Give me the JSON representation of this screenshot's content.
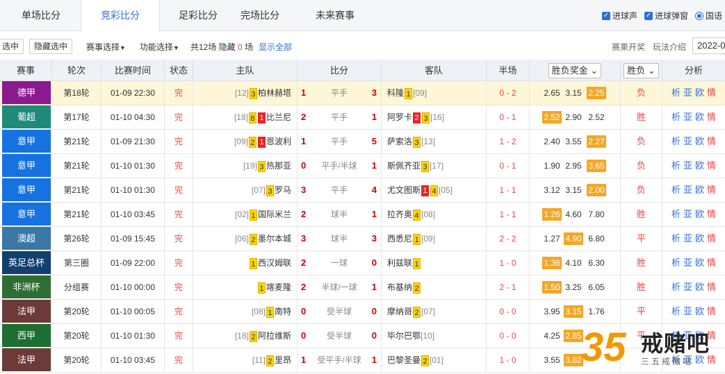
{
  "tabs": [
    "单场比分",
    "竞彩比分",
    "足彩比分",
    "完场比分",
    "未来赛事"
  ],
  "options": [
    {
      "label": "进球声",
      "type": "checkbox"
    },
    {
      "label": "进球弹窗",
      "type": "checkbox"
    },
    {
      "label": "国语",
      "type": "radio"
    }
  ],
  "toolbar": {
    "keep_selected": "选中",
    "hide_selected": "隐藏选中",
    "match_select": "赛事选择",
    "func_select": "功能选择",
    "total_prefix": "共12场 隐藏",
    "hidden_count": "0",
    "hidden_suffix": "场",
    "show_all": "显示全部",
    "open_btn": "赛果开奖",
    "rules_btn": "玩法介绍",
    "season": "2022-0"
  },
  "columns": [
    "赛事",
    "轮次",
    "比赛时间",
    "状态",
    "主队",
    "比分",
    "客队",
    "半场",
    "胜负奖金",
    "胜负",
    "分析"
  ],
  "analysis_items": [
    "析",
    "亚",
    "欧",
    "情"
  ],
  "matches": [
    {
      "league": "德甲",
      "color": "#8b1a8f",
      "round": "第18轮",
      "time": "01-09 22:30",
      "status": "完",
      "home_rank": "[12]",
      "home_cards": [
        {
          "t": "y",
          "n": "3"
        }
      ],
      "home": "柏林赫塔",
      "hs": "1",
      "handicap": "平手",
      "as": "3",
      "away": "科隆",
      "away_cards": [
        {
          "t": "y",
          "n": "1"
        }
      ],
      "away_rank": "[09]",
      "half": "0 - 2",
      "odds": [
        "2.65",
        "3.15",
        "2.25"
      ],
      "win_idx": 2,
      "result": "负"
    },
    {
      "league": "葡超",
      "color": "#1f8a7a",
      "round": "第17轮",
      "time": "01-10 04:30",
      "status": "完",
      "home_rank": "[18]",
      "home_cards": [
        {
          "t": "y",
          "n": "8"
        },
        {
          "t": "r",
          "n": "1"
        }
      ],
      "home": "比兰尼",
      "hs": "2",
      "handicap": "平手",
      "as": "1",
      "away": "阿罗卡",
      "away_cards": [
        {
          "t": "r",
          "n": "2"
        },
        {
          "t": "y",
          "n": "3"
        }
      ],
      "away_rank": "[16]",
      "half": "0 - 1",
      "odds": [
        "2.52",
        "2.90",
        "2.52"
      ],
      "win_idx": 0,
      "result": "胜"
    },
    {
      "league": "意甲",
      "color": "#1672e0",
      "round": "第21轮",
      "time": "01-09 21:30",
      "status": "完",
      "home_rank": "[09]",
      "home_cards": [
        {
          "t": "y",
          "n": "2"
        },
        {
          "t": "r",
          "n": "1"
        }
      ],
      "home": "恩波利",
      "hs": "1",
      "handicap": "平手",
      "as": "5",
      "away": "萨索洛",
      "away_cards": [
        {
          "t": "y",
          "n": "3"
        }
      ],
      "away_rank": "[13]",
      "half": "1 - 2",
      "odds": [
        "2.40",
        "3.55",
        "2.27"
      ],
      "win_idx": 2,
      "result": "负"
    },
    {
      "league": "意甲",
      "color": "#1672e0",
      "round": "第21轮",
      "time": "01-10 01:30",
      "status": "完",
      "home_rank": "[19]",
      "home_cards": [
        {
          "t": "y",
          "n": "3"
        }
      ],
      "home": "热那亚",
      "hs": "0",
      "handicap": "平手/半球",
      "as": "1",
      "away": "斯佩齐亚",
      "away_cards": [
        {
          "t": "y",
          "n": "3"
        }
      ],
      "away_rank": "[17]",
      "half": "0 - 1",
      "odds": [
        "1.90",
        "2.95",
        "3.65"
      ],
      "win_idx": 2,
      "result": "负"
    },
    {
      "league": "意甲",
      "color": "#1672e0",
      "round": "第21轮",
      "time": "01-10 01:30",
      "status": "完",
      "home_rank": "[07]",
      "home_cards": [
        {
          "t": "y",
          "n": "3"
        }
      ],
      "home": "罗马",
      "hs": "3",
      "handicap": "平手",
      "as": "4",
      "away": "尤文图斯",
      "away_cards": [
        {
          "t": "r",
          "n": "1"
        },
        {
          "t": "y",
          "n": "4"
        }
      ],
      "away_rank": "[05]",
      "half": "1 - 1",
      "odds": [
        "3.12",
        "3.15",
        "2.00"
      ],
      "win_idx": 2,
      "result": "负"
    },
    {
      "league": "意甲",
      "color": "#1672e0",
      "round": "第21轮",
      "time": "01-10 03:45",
      "status": "完",
      "home_rank": "[02]",
      "home_cards": [
        {
          "t": "y",
          "n": "1"
        }
      ],
      "home": "国际米兰",
      "hs": "2",
      "handicap": "球半",
      "as": "1",
      "away": "拉齐奥",
      "away_cards": [
        {
          "t": "y",
          "n": "4"
        }
      ],
      "away_rank": "[08]",
      "half": "1 - 1",
      "odds": [
        "1.26",
        "4.60",
        "7.80"
      ],
      "win_idx": 0,
      "result": "胜"
    },
    {
      "league": "澳超",
      "color": "#3a78a8",
      "round": "第26轮",
      "time": "01-09 15:45",
      "status": "完",
      "home_rank": "[06]",
      "home_cards": [
        {
          "t": "y",
          "n": "2"
        }
      ],
      "home": "墨尔本城",
      "hs": "3",
      "handicap": "球半",
      "as": "3",
      "away": "西悉尼",
      "away_cards": [
        {
          "t": "y",
          "n": "1"
        }
      ],
      "away_rank": "[09]",
      "half": "2 - 2",
      "odds": [
        "1.27",
        "4.90",
        "6.80"
      ],
      "win_idx": 1,
      "result": "平"
    },
    {
      "league": "英足总杯",
      "color": "#12406e",
      "round": "第三圈",
      "time": "01-09 22:00",
      "status": "完",
      "home_rank": "",
      "home_cards": [
        {
          "t": "y",
          "n": "1"
        }
      ],
      "home": "西汉姆联",
      "hs": "2",
      "handicap": "一球",
      "as": "0",
      "away": "利兹联",
      "away_cards": [
        {
          "t": "y",
          "n": "1"
        }
      ],
      "away_rank": "",
      "half": "1 - 0",
      "odds": [
        "1.36",
        "4.10",
        "6.30"
      ],
      "win_idx": 0,
      "result": "胜"
    },
    {
      "league": "非洲杯",
      "color": "#2f6e33",
      "round": "分组赛",
      "time": "01-10 00:00",
      "status": "完",
      "home_rank": "",
      "home_cards": [
        {
          "t": "y",
          "n": "1"
        }
      ],
      "home": "喀麦隆",
      "hs": "2",
      "handicap": "半球/一球",
      "as": "1",
      "away": "布基纳",
      "away_cards": [
        {
          "t": "y",
          "n": "2"
        }
      ],
      "away_rank": "",
      "half": "2 - 1",
      "odds": [
        "1.50",
        "3.25",
        "6.05"
      ],
      "win_idx": 0,
      "result": "胜"
    },
    {
      "league": "法甲",
      "color": "#6d3a3a",
      "round": "第20轮",
      "time": "01-10 00:05",
      "status": "完",
      "home_rank": "[08]",
      "home_cards": [
        {
          "t": "y",
          "n": "1"
        }
      ],
      "home": "南特",
      "hs": "0",
      "handicap": "受半球",
      "as": "0",
      "away": "摩纳哥",
      "away_cards": [
        {
          "t": "y",
          "n": "2"
        }
      ],
      "away_rank": "[07]",
      "half": "0 - 0",
      "odds": [
        "3.95",
        "3.15",
        "1.76"
      ],
      "win_idx": 1,
      "result": "平"
    },
    {
      "league": "西甲",
      "color": "#1b6f30",
      "round": "第20轮",
      "time": "01-10 01:30",
      "status": "完",
      "home_rank": "[18]",
      "home_cards": [
        {
          "t": "y",
          "n": "2"
        }
      ],
      "home": "阿拉维斯",
      "hs": "0",
      "handicap": "受半球",
      "as": "0",
      "away": "毕尔巴鄂",
      "away_cards": [],
      "away_rank": "[10]",
      "half": "0 - 0",
      "odds": [
        "4.25",
        "2.85",
        ""
      ],
      "win_idx": 1,
      "result": "平"
    },
    {
      "league": "法甲",
      "color": "#6d3a3a",
      "round": "第20轮",
      "time": "01-10 03:45",
      "status": "完",
      "home_rank": "[11]",
      "home_cards": [
        {
          "t": "y",
          "n": "2"
        }
      ],
      "home": "里昂",
      "hs": "1",
      "handicap": "受平手/半球",
      "as": "1",
      "away": "巴黎圣曼",
      "away_cards": [
        {
          "t": "y",
          "n": "2"
        }
      ],
      "away_rank": "[01]",
      "half": "1 - 0",
      "odds": [
        "3.55",
        "3.82",
        ""
      ],
      "win_idx": 1,
      "result": ""
    }
  ],
  "watermark": {
    "num": "35",
    "title": "戒赌吧",
    "sub": "三五戒赌吧"
  }
}
